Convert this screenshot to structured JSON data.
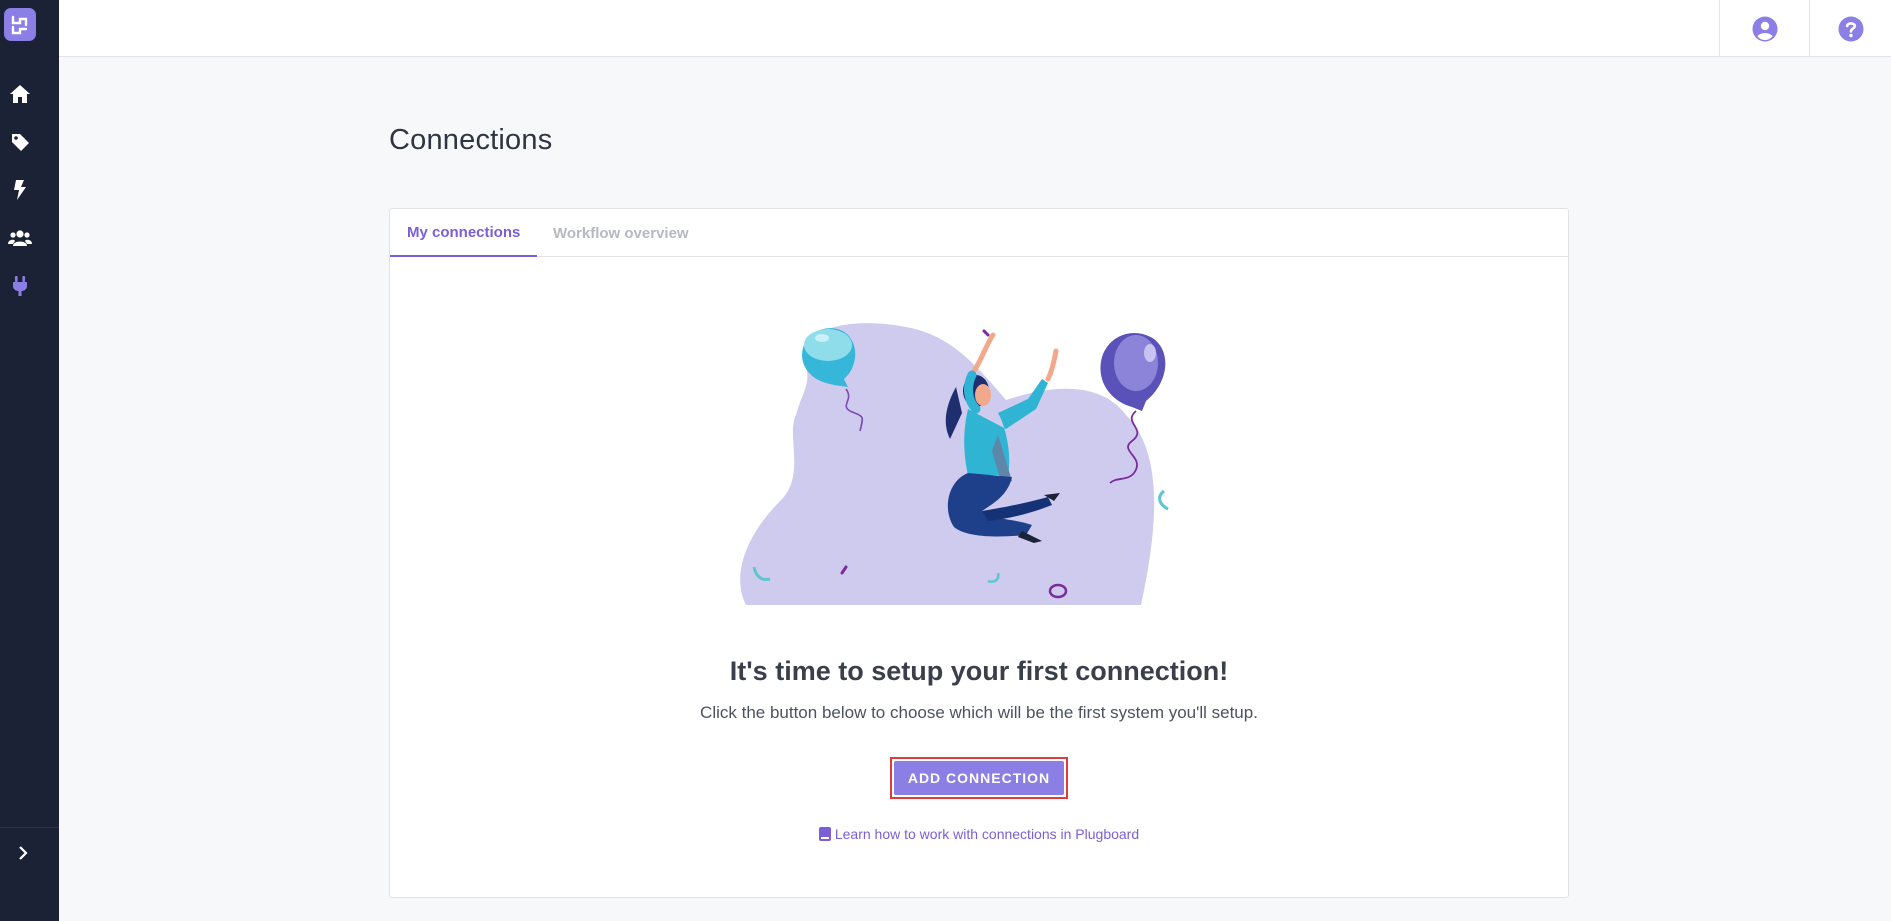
{
  "app": {
    "brand_color": "#8b7fe6",
    "accent_color": "#7a5fd6",
    "sidebar_color": "#1b2236"
  },
  "sidebar": {
    "items": [
      {
        "icon": "home-icon"
      },
      {
        "icon": "tag-icon"
      },
      {
        "icon": "lightning-icon"
      },
      {
        "icon": "users-icon"
      },
      {
        "icon": "plug-icon"
      }
    ],
    "expand_icon": "chevron-right-icon"
  },
  "topbar": {
    "actions": [
      {
        "icon": "user-account-icon"
      },
      {
        "icon": "help-icon"
      }
    ]
  },
  "page": {
    "title": "Connections",
    "tabs": [
      {
        "label": "My connections",
        "active": true
      },
      {
        "label": "Workflow overview",
        "active": false
      }
    ],
    "empty_state": {
      "illustration": "celebrating-woman-with-balloons",
      "headline": "It's time to setup your first connection!",
      "subtext": "Click the button below to choose which will be the first system you'll setup.",
      "button_label": "ADD CONNECTION",
      "help_link": "Learn how to work with connections in Plugboard",
      "help_icon": "book-icon"
    }
  }
}
